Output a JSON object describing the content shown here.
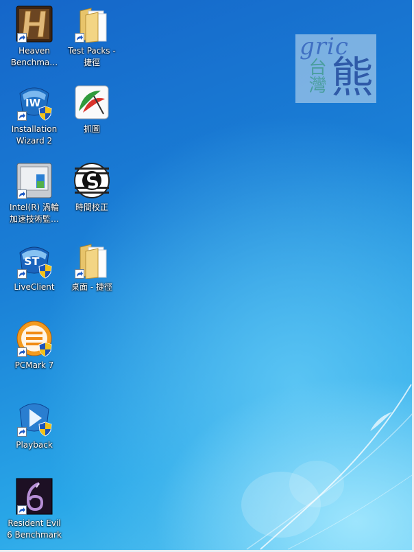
{
  "desktop": {
    "watermark": {
      "latin": "gric",
      "small": "台灣",
      "big": "熊"
    },
    "icons": [
      {
        "label": "Heaven\nBenchma…",
        "icon": "heaven-benchmark-icon"
      },
      {
        "label": "Test Packs -\n捷徑",
        "icon": "folder-icon"
      },
      {
        "label": "Installation\nWizard 2",
        "icon": "installation-wizard-icon"
      },
      {
        "label": "抓圖",
        "icon": "screen-capture-icon"
      },
      {
        "label": "Intel(R) 渦輪\n加速技術監…",
        "icon": "intel-turbo-monitor-icon"
      },
      {
        "label": "時間校正",
        "icon": "time-sync-icon"
      },
      {
        "label": "LiveClient",
        "icon": "liveclient-icon"
      },
      {
        "label": "桌面 - 捷徑",
        "icon": "folder-icon"
      },
      {
        "label": "PCMark 7",
        "icon": "pcmark-icon"
      },
      {
        "label": "Playback",
        "icon": "playback-icon"
      },
      {
        "label": "Resident Evil\n6 Benchmark",
        "icon": "resident-evil-icon"
      }
    ]
  }
}
